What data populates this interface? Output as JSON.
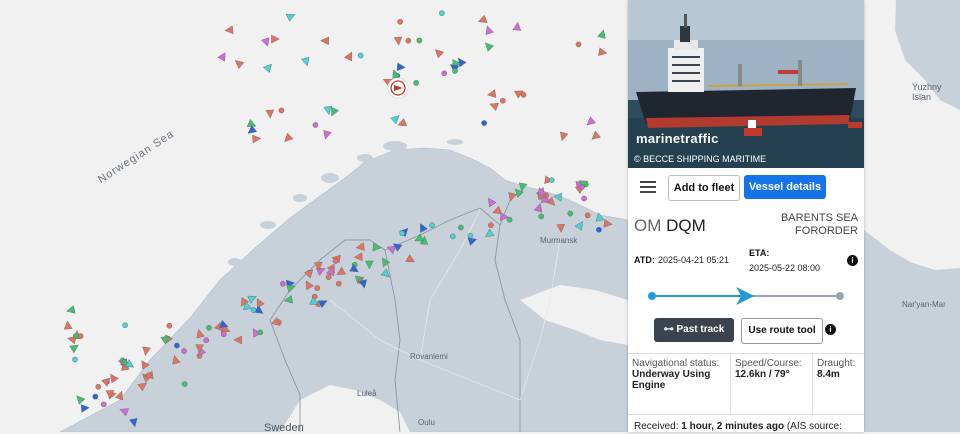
{
  "map": {
    "labels": {
      "norwegian_sea": "Norwegian Sea",
      "murmansk": "Murmansk",
      "rovaniemi": "Rovaniemi",
      "lulea": "Luleå",
      "sweden": "Sweden",
      "oulu": "Oulu",
      "yuzhny": "Yuzhny Islan",
      "naryan_mar": "Nar'yan-Mar"
    },
    "colors": {
      "sea": "#f1f1f1",
      "land": "#c8d1d9",
      "border": "#8a96a3",
      "tanker": "#e2735f",
      "cargo": "#3fc26d",
      "passenger": "#2a66d9",
      "other": "#d06bd6",
      "fishing": "#49d3d3"
    }
  },
  "vessel_panel": {
    "photo": {
      "brand": "marinetraffic",
      "caption": "© BECCE SHIPPING MARITIME"
    },
    "toolbar": {
      "menu_icon": "hamburger-menu-icon",
      "add_to_fleet": "Add to fleet",
      "vessel_details": "Vessel details"
    },
    "name_prefix": "OM",
    "name": "DQM",
    "destination": "BARENTS SEA FORORDER",
    "atd_label": "ATD:",
    "atd_value": "2025-04-21 05:21",
    "eta_label": "ETA:",
    "eta_value": "2025-05-22 08:00",
    "info_icon": "i",
    "voyage_progress": 0.48,
    "past_track_label": "Past track",
    "route_tool_label": "Use route tool",
    "nav_status_label": "Navigational status:",
    "nav_status_value": "Underway Using Engine",
    "speed_label": "Speed/Course:",
    "speed_value": "12.6kn / 79°",
    "draught_label": "Draught:",
    "draught_value": "8.4m",
    "received_label": "Received:",
    "received_value": "1 hour, 2 minutes ago",
    "received_suffix": "(AIS source:"
  }
}
